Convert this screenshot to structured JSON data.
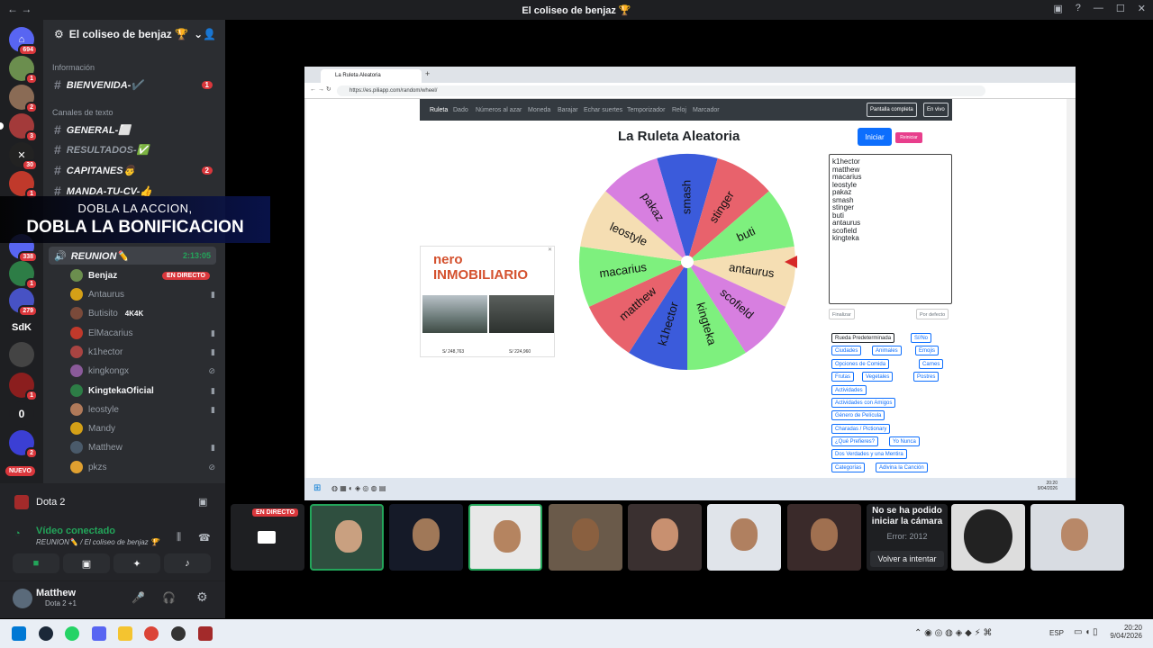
{
  "window": {
    "title": "El coliseo de benjaz 🏆"
  },
  "server": {
    "name": "El coliseo de benjaz 🏆"
  },
  "rail": {
    "badges": [
      "694",
      "1",
      "2",
      "3",
      "30",
      "1",
      "338",
      "1",
      "279",
      "SdK",
      "1",
      "0",
      "2",
      "NUEVO"
    ]
  },
  "channels": {
    "cat_info": "Información",
    "cat_text": "Canales de texto",
    "items": [
      {
        "name": "BIENVENIDA-✔️",
        "badge": "1"
      },
      {
        "name": "GENERAL-⬜"
      },
      {
        "name": "RESULTADOS-✅"
      },
      {
        "name": "CAPITANES👨",
        "badge": "2"
      },
      {
        "name": "MANDA-TU-CV-👍"
      }
    ],
    "voice_channel": "REUNION✏️",
    "voice_time": "2:13:05",
    "voice_users": [
      {
        "name": "Benjaz",
        "live": "EN DIRECTO"
      },
      {
        "name": "Antaurus"
      },
      {
        "name": "Butisito",
        "tag": "4K4K"
      },
      {
        "name": "ElMacarius"
      },
      {
        "name": "k1hector"
      },
      {
        "name": "kingkongx"
      },
      {
        "name": "KingtekaOficial"
      },
      {
        "name": "leostyle"
      },
      {
        "name": "Mandy"
      },
      {
        "name": "Matthew"
      },
      {
        "name": "pkzs"
      }
    ]
  },
  "promo": {
    "line1": "DOBLA LA ACCION,",
    "line2": "DOBLA LA BONIFICACION"
  },
  "activity": {
    "game": "Dota 2"
  },
  "voice_panel": {
    "status": "Vídeo conectado",
    "location": "REUNION✏️ / El coliseo de benjaz 🏆"
  },
  "user": {
    "name": "Matthew",
    "status": "Dota 2 +1"
  },
  "browser": {
    "tab_title": "La Ruleta Aleatoria",
    "url": "https://es.piliapp.com/random/wheel/"
  },
  "site": {
    "nav": [
      "Ruleta",
      "Dado",
      "Números al azar",
      "Moneda",
      "Barajar",
      "Echar suertes",
      "Temporizador",
      "Reloj",
      "Marcador"
    ],
    "btn_fullscreen": "Pantalla completa",
    "btn_live": "En vivo",
    "title": "La Ruleta Aleatoria",
    "btn_start": "Iniciar",
    "btn_reset": "Reiniciar",
    "names": [
      "k1hector",
      "matthew",
      "macarius",
      "leostyle",
      "pakaz",
      "smash",
      "stinger",
      "buti",
      "antaurus",
      "scofield",
      "kingteka"
    ],
    "btn_finish": "Finalizar",
    "btn_default": "Por defecto",
    "presets": [
      "Rueda Predeterminada",
      "Sí/No",
      "Ciudades",
      "Animales",
      "Emojis",
      "Opciones de Comida",
      "Carnes",
      "Frutas",
      "Vegetales",
      "Postres",
      "Actividades",
      "Actividades con Amigos",
      "Género de Película",
      "Charadas / Pictionary",
      "¿Qué Prefieres?",
      "Yo Nunca",
      "Dos Verdades y una Mentira",
      "Categorías",
      "Adivina la Canción"
    ],
    "ad": {
      "brand": "nero INMOBILIARIO",
      "price1": "S/ 248,763",
      "price2": "S/ 224,960"
    }
  },
  "wheel_segments": [
    {
      "label": "smash",
      "color": "#3b5bdb"
    },
    {
      "label": "stinger",
      "color": "#e8626c"
    },
    {
      "label": "buti",
      "color": "#7ef07e"
    },
    {
      "label": "antaurus",
      "color": "#f5deb3"
    },
    {
      "label": "scofield",
      "color": "#d77fe0"
    },
    {
      "label": "kingteka",
      "color": "#7ef07e"
    },
    {
      "label": "k1hector",
      "color": "#3b5bdb"
    },
    {
      "label": "matthew",
      "color": "#e8626c"
    },
    {
      "label": "macarius",
      "color": "#7ef07e"
    },
    {
      "label": "leostyle",
      "color": "#f5deb3"
    },
    {
      "label": "pakaz",
      "color": "#d77fe0"
    }
  ],
  "inner_taskbar": {
    "time": "20:20",
    "date": "9/04/2026"
  },
  "tiles": {
    "live_label": "EN DIRECTO",
    "error_title": "No se ha podido iniciar la cámara",
    "error_code": "Error: 2012",
    "retry": "Volver a intentar"
  },
  "taskbar": {
    "lang": "ESP",
    "time": "20:20",
    "date": "9/04/2026"
  }
}
